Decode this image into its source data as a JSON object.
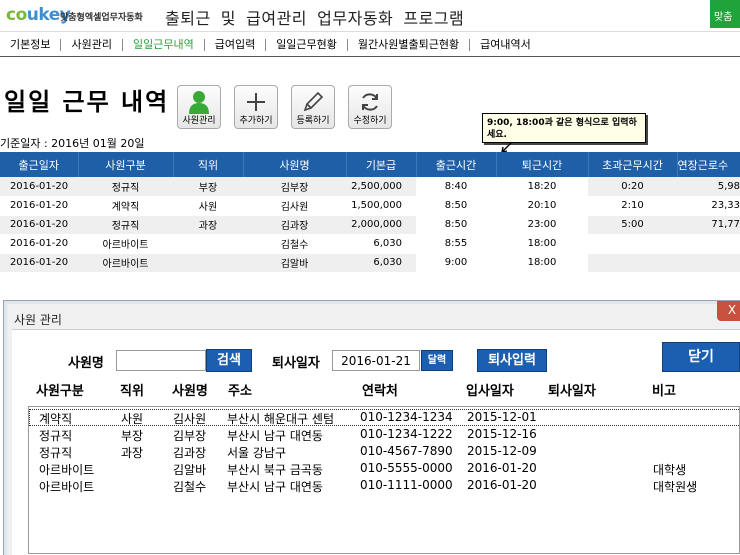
{
  "header": {
    "logo_co": "co",
    "logo_key": "ukey",
    "logo_sub": "맞춤형엑셀업무자동화",
    "title": "출퇴근 및 급여관리 업무자동화 프로그램",
    "corner_btn": "맞춤"
  },
  "nav": [
    {
      "label": "기본정보",
      "active": false
    },
    {
      "label": "사원관리",
      "active": false
    },
    {
      "label": "일일근무내역",
      "active": true
    },
    {
      "label": "급여입력",
      "active": false
    },
    {
      "label": "일일근무현황",
      "active": false
    },
    {
      "label": "월간사원별출퇴근현황",
      "active": false
    },
    {
      "label": "급여내역서",
      "active": false
    }
  ],
  "page": {
    "title": "일일 근무 내역",
    "base_date": "기준일자 : 2016년 01월 20일",
    "tooltip": "9:00, 18:00과 같은 형식으로 입력하세요."
  },
  "toolbar": {
    "employee": "사원관리",
    "add": "추가하기",
    "register": "등록하기",
    "edit": "수정하기"
  },
  "grid": {
    "headers": [
      "출근일자",
      "사원구분",
      "직위",
      "사원명",
      "기본급",
      "출근시간",
      "퇴근시간",
      "초과근무시간",
      "연장근로수"
    ],
    "rows": [
      [
        "2016-01-20",
        "정규직",
        "부장",
        "김부장",
        "2,500,000",
        "8:40",
        "18:20",
        "0:20",
        "5,98"
      ],
      [
        "2016-01-20",
        "계약직",
        "사원",
        "김사원",
        "1,500,000",
        "8:50",
        "20:10",
        "2:10",
        "23,33"
      ],
      [
        "2016-01-20",
        "정규직",
        "과장",
        "김과장",
        "2,000,000",
        "8:50",
        "23:00",
        "5:00",
        "71,77"
      ],
      [
        "2016-01-20",
        "아르바이트",
        "",
        "김철수",
        "6,030",
        "8:55",
        "18:00",
        "",
        ""
      ],
      [
        "2016-01-20",
        "아르바이트",
        "",
        "김알바",
        "6,030",
        "9:00",
        "18:00",
        "",
        ""
      ]
    ]
  },
  "dialog": {
    "title": "사원 관리",
    "close": "X",
    "name_label": "사원명",
    "name_value": "",
    "search_btn": "검색",
    "leave_label": "퇴사일자",
    "leave_value": "2016-01-21",
    "calendar_btn": "달력",
    "leave_input_btn": "퇴사입력",
    "close_btn": "닫기",
    "columns": [
      "사원구분",
      "직위",
      "사원명",
      "주소",
      "연락처",
      "입사일자",
      "퇴사일자",
      "비고"
    ],
    "rows": [
      [
        "계약직",
        "사원",
        "김사원",
        "부산시 해운대구 센텀",
        "010-1234-1234",
        "2015-12-01",
        "",
        ""
      ],
      [
        "정규직",
        "부장",
        "김부장",
        "부산시 남구 대연동",
        "010-1234-1222",
        "2015-12-16",
        "",
        ""
      ],
      [
        "정규직",
        "과장",
        "김과장",
        "서울 강남구",
        "010-4567-7890",
        "2015-12-09",
        "",
        ""
      ],
      [
        "아르바이트",
        "",
        "김알바",
        "부산시 북구 금곡동",
        "010-5555-0000",
        "2016-01-20",
        "",
        "대학생"
      ],
      [
        "아르바이트",
        "",
        "김철수",
        "부산시 남구 대연동",
        "010-1111-0000",
        "2016-01-20",
        "",
        "대학원생"
      ]
    ]
  },
  "colors": {
    "header_blue": "#1f5fa8",
    "nav_active": "#2a9d3a",
    "button_blue": "#1c5fb0",
    "logo_green": "#7ab83a",
    "logo_blue": "#3f8fd0"
  }
}
